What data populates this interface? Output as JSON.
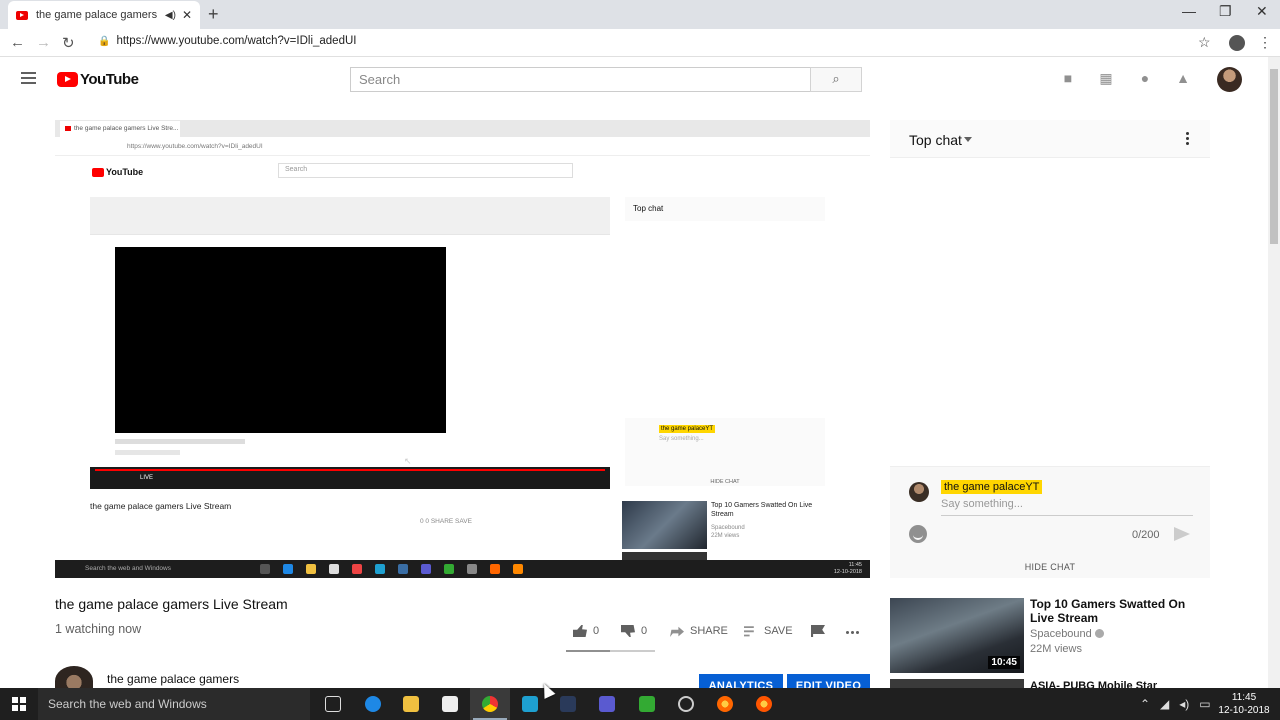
{
  "browser": {
    "tab_title": "the game palace gamers Live Stream - YouTube",
    "url": "https://www.youtube.com/watch?v=IDli_adedUI",
    "new_tab_icon": "plus-icon",
    "controls": [
      "back-icon",
      "forward-icon",
      "reload-icon"
    ]
  },
  "youtube": {
    "logo_text": "YouTube",
    "search_placeholder": "Search",
    "header_icons": [
      "create-video-icon",
      "apps-grid-icon",
      "messages-icon",
      "bell-icon"
    ]
  },
  "player": {
    "inner_tab_title": "the game palace gamers Live Stre...",
    "inner_url": "https://www.youtube.com/watch?v=IDli_adedUI",
    "inner_logo": "YouTube",
    "inner_search": "Search",
    "inner_top_chat": "Top chat",
    "live_label": "LIVE",
    "inner_video_title": "the game palace gamers Live Stream",
    "inner_actions": "0     0     SHARE     SAVE",
    "inner_chat_user": "the game palaceYT",
    "inner_say": "Say something...",
    "inner_hide_chat": "HIDE CHAT",
    "inner_rel_title": "Top 10 Gamers Swatted On Live Stream",
    "inner_rel_channel": "Spacebound",
    "inner_rel_views": "22M views",
    "inner_taskbar_search": "Search the web and Windows",
    "inner_time": "11:45",
    "inner_date": "12-10-2018"
  },
  "chat": {
    "header": "Top chat",
    "user_name": "the game palaceYT",
    "input_placeholder": "Say something...",
    "char_count": "0/200",
    "hide_chat": "HIDE CHAT"
  },
  "video": {
    "title": "the game palace gamers Live Stream",
    "watching": "1 watching now",
    "likes": "0",
    "dislikes": "0",
    "share": "SHARE",
    "save": "SAVE",
    "channel_name": "the game palace gamers",
    "analytics_button": "ANALYTICS",
    "edit_button": "EDIT VIDEO"
  },
  "related": [
    {
      "title": "Top 10 Gamers Swatted On Live Stream",
      "channel": "Spacebound",
      "views": "22M views",
      "duration": "10:45"
    },
    {
      "title": "ASIA- PUBG Mobile Star"
    }
  ],
  "taskbar": {
    "search_text": "Search the web and Windows",
    "time": "11:45",
    "date": "12-10-2018"
  },
  "colors": {
    "youtube_red": "#ff0000",
    "button_blue": "#065fd4",
    "chat_highlight": "#ffd600"
  }
}
